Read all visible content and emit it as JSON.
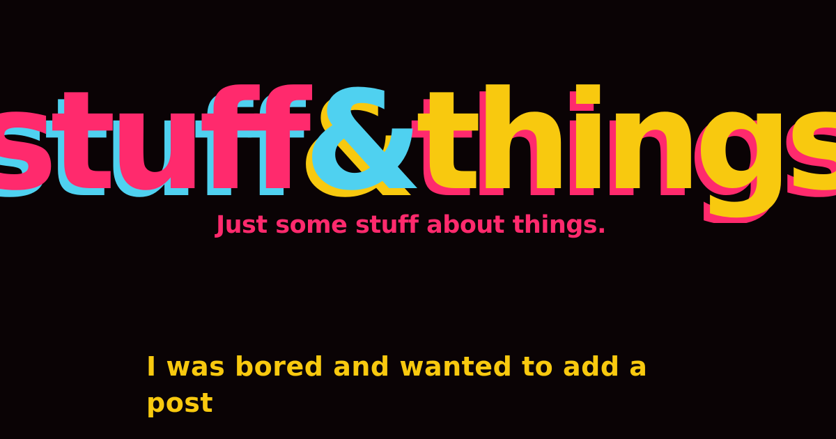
{
  "logo": {
    "part1": "stuff",
    "ampersand": "&",
    "part2": "things"
  },
  "tagline": "Just some stuff about things.",
  "post": {
    "title": "I was bored and wanted to add a post"
  },
  "colors": {
    "background": "#0a0305",
    "pink": "#ff2a6d",
    "cyan": "#4fd1f0",
    "yellow": "#f8c90f"
  }
}
